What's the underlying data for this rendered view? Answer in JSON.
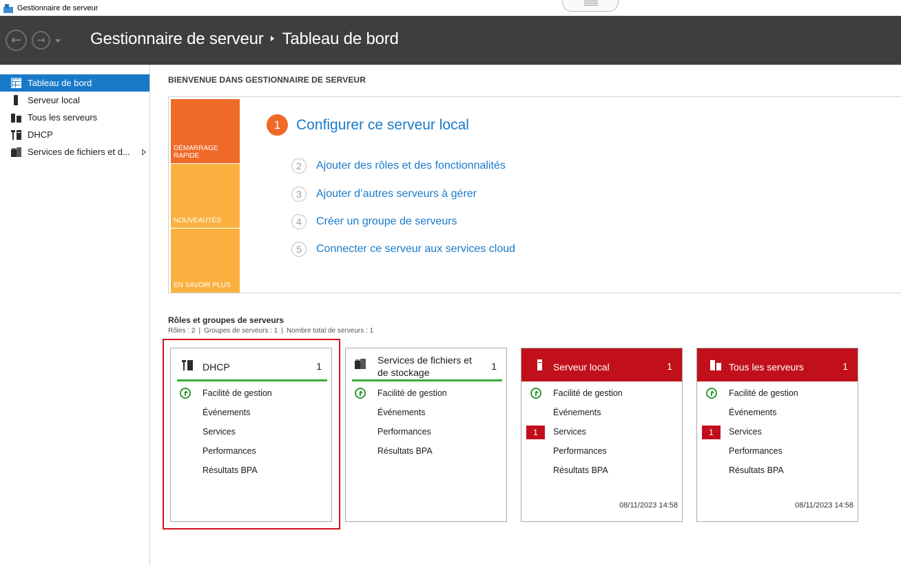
{
  "window": {
    "title": "Gestionnaire de serveur"
  },
  "header": {
    "app": "Gestionnaire de serveur",
    "page": "Tableau de bord"
  },
  "sidebar": {
    "items": [
      {
        "label": "Tableau de bord",
        "icon": "dashboard-icon",
        "active": true
      },
      {
        "label": "Serveur local",
        "icon": "server-icon"
      },
      {
        "label": "Tous les serveurs",
        "icon": "servers-icon"
      },
      {
        "label": "DHCP",
        "icon": "dhcp-icon"
      },
      {
        "label": "Services de fichiers et d...",
        "icon": "file-services-icon",
        "expandable": true
      }
    ]
  },
  "welcome": {
    "title": "BIENVENUE DANS GESTIONNAIRE DE SERVEUR",
    "tiles": [
      "DÉMARRAGE RAPIDE",
      "NOUVEAUTÉS",
      "EN SAVOIR PLUS"
    ],
    "steps": [
      {
        "num": "1",
        "label": "Configurer ce serveur local"
      },
      {
        "num": "2",
        "label": "Ajouter des rôles et des fonctionnalités"
      },
      {
        "num": "3",
        "label": "Ajouter d’autres serveurs à gérer"
      },
      {
        "num": "4",
        "label": "Créer un groupe de serveurs"
      },
      {
        "num": "5",
        "label": "Connecter ce serveur aux services cloud"
      }
    ]
  },
  "roles": {
    "title": "Rôles et groupes de serveurs",
    "summary": {
      "roles": "Rôles : 2",
      "groups": "Groupes de serveurs : 1",
      "total": "Nombre total de serveurs : 1"
    },
    "cards": [
      {
        "title": "DHCP",
        "count": "1",
        "style": "green",
        "rows": [
          "Facilité de gestion",
          "Événements",
          "Services",
          "Performances",
          "Résultats BPA"
        ],
        "date": ""
      },
      {
        "title": "Services de fichiers et de stockage",
        "title_line1": "Services de fichiers et",
        "title_line2": "de stockage",
        "count": "1",
        "style": "green",
        "rows": [
          "Facilité de gestion",
          "Événements",
          "Performances",
          "Résultats BPA"
        ],
        "date": ""
      },
      {
        "title": "Serveur local",
        "count": "1",
        "style": "red",
        "rows": [
          "Facilité de gestion",
          "Événements",
          "Services",
          "Performances",
          "Résultats BPA"
        ],
        "services_badge": "1",
        "date": "08/11/2023 14:58"
      },
      {
        "title": "Tous les serveurs",
        "count": "1",
        "style": "red",
        "rows": [
          "Facilité de gestion",
          "Événements",
          "Services",
          "Performances",
          "Résultats BPA"
        ],
        "services_badge": "1",
        "date": "08/11/2023 14:58"
      }
    ]
  },
  "colors": {
    "accent": "#1979c9",
    "header_bg": "#3e3e3e",
    "quick_start": "#ef6928",
    "tile_yellow": "#fbb040",
    "alert_red": "#c1101b",
    "ok_green": "#3aaa35",
    "highlight": "#d0101b"
  }
}
